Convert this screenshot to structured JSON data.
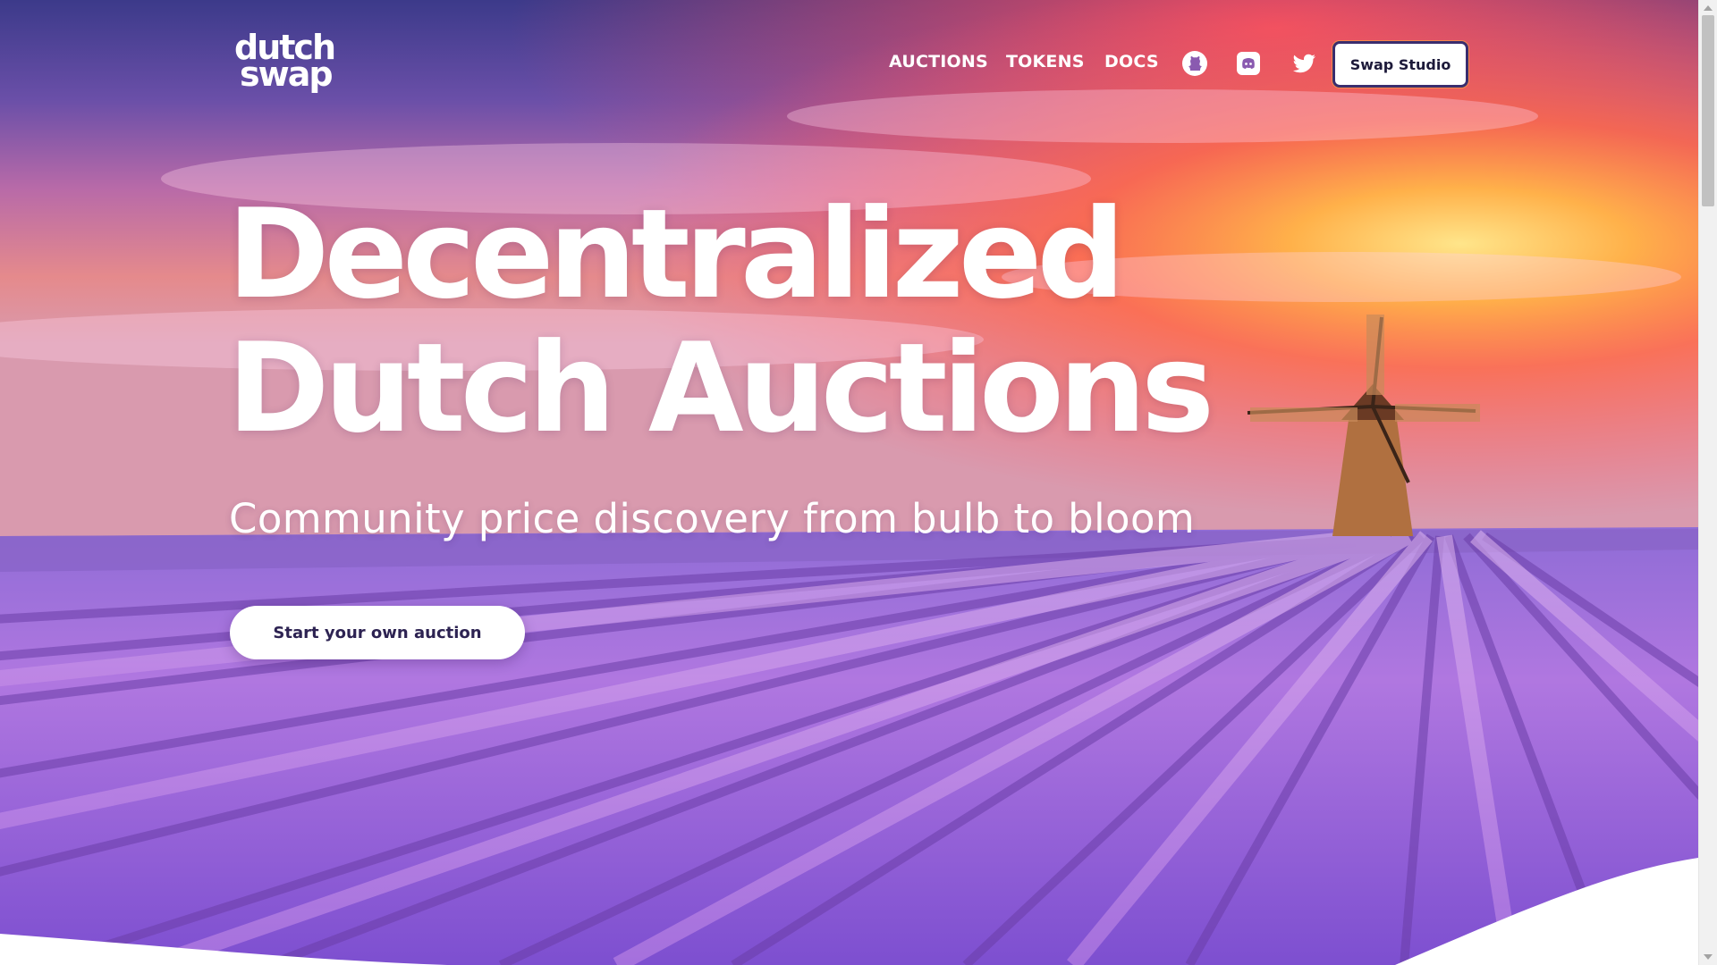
{
  "brand": {
    "logo_line1": "dutch",
    "logo_line2": "swap"
  },
  "nav": {
    "links": [
      "AUCTIONS",
      "TOKENS",
      "DOCS"
    ],
    "icons": [
      "github-icon",
      "discord-icon",
      "twitter-icon"
    ],
    "cta_label": "Swap Studio"
  },
  "hero": {
    "headline_line1": "Decentralized",
    "headline_line2": "Dutch Auctions",
    "subheadline": "Community price discovery from bulb to bloom",
    "cta_label": "Start your own auction",
    "image_subject": "windmill over rows of purple hyacinth fields at sunset"
  },
  "colors": {
    "text_light": "#ffffff",
    "button_border": "#3a2d6e",
    "button_text": "#1d1a3a",
    "cta_text": "#2d2352",
    "sky_top": "#3f3d8f",
    "sky_sunset": "#ff8a3d",
    "field": "#9b5fe0"
  }
}
